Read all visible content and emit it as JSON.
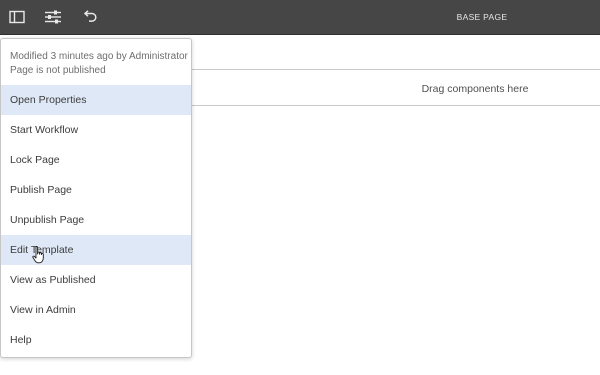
{
  "toolbar": {
    "icons": [
      "sidebar-toggle-icon",
      "page-properties-sliders-icon",
      "undo-icon"
    ],
    "title": "BASE PAGE",
    "background": "#464646"
  },
  "canvas": {
    "dropzone_label": "Drag components here"
  },
  "page_info": {
    "modified": "Modified 3 minutes ago by Administrator",
    "status": "Page is not published",
    "menu": [
      {
        "label": "Open Properties",
        "highlighted": true
      },
      {
        "label": "Start Workflow",
        "highlighted": false
      },
      {
        "label": "Lock Page",
        "highlighted": false
      },
      {
        "label": "Publish Page",
        "highlighted": false
      },
      {
        "label": "Unpublish Page",
        "highlighted": false
      },
      {
        "label": "Edit Template",
        "highlighted": true
      },
      {
        "label": "View as Published",
        "highlighted": false
      },
      {
        "label": "View in Admin",
        "highlighted": false
      },
      {
        "label": "Help",
        "highlighted": false
      }
    ],
    "highlight_color": "#dfe8f6"
  }
}
